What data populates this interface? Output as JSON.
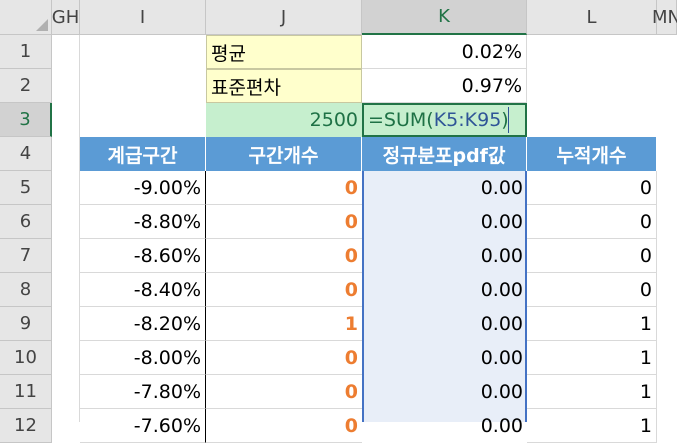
{
  "columns": {
    "gh": "GH",
    "i": "I",
    "j": "J",
    "k": "K",
    "l": "L",
    "mn": "MN"
  },
  "rows": [
    "1",
    "2",
    "3",
    "4",
    "5",
    "6",
    "7",
    "8",
    "9",
    "10",
    "11",
    "12"
  ],
  "stats": {
    "mean_label": "평균",
    "mean_value": "0.02%",
    "std_label": "표준편차",
    "std_value": "0.97%",
    "total": "2500",
    "formula_prefix": "=SUM(",
    "formula_ref": "K5:K95",
    "formula_suffix": ")"
  },
  "table": {
    "headers": [
      "계급구간",
      "구간개수",
      "정규분포pdf값",
      "누적개수"
    ],
    "rows": [
      [
        "-9.00%",
        "0",
        "0.00",
        "0"
      ],
      [
        "-8.80%",
        "0",
        "0.00",
        "0"
      ],
      [
        "-8.60%",
        "0",
        "0.00",
        "0"
      ],
      [
        "-8.40%",
        "0",
        "0.00",
        "0"
      ],
      [
        "-8.20%",
        "1",
        "0.00",
        "1"
      ],
      [
        "-8.00%",
        "0",
        "0.00",
        "1"
      ],
      [
        "-7.80%",
        "0",
        "0.00",
        "1"
      ],
      [
        "-7.60%",
        "0",
        "0.00",
        "1"
      ]
    ]
  },
  "colors": {
    "header_blue": "#5b9bd5",
    "count_orange": "#ed7d31",
    "input_yellow": "#ffffcc",
    "sum_green": "#c6efce"
  }
}
